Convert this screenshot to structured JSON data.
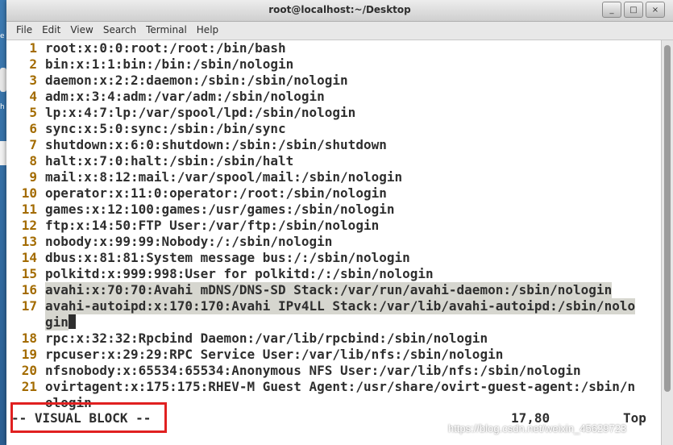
{
  "desktop": {
    "icon_labels": [
      "e",
      "h"
    ]
  },
  "window": {
    "title": "root@localhost:~/Desktop",
    "buttons": {
      "minimize": "_",
      "maximize": "□",
      "close": "×"
    }
  },
  "menu": [
    "File",
    "Edit",
    "View",
    "Search",
    "Terminal",
    "Help"
  ],
  "lines": [
    {
      "n": "1",
      "text": "root:x:0:0:root:/root:/bin/bash"
    },
    {
      "n": "2",
      "text": "bin:x:1:1:bin:/bin:/sbin/nologin"
    },
    {
      "n": "3",
      "text": "daemon:x:2:2:daemon:/sbin:/sbin/nologin"
    },
    {
      "n": "4",
      "text": "adm:x:3:4:adm:/var/adm:/sbin/nologin"
    },
    {
      "n": "5",
      "text": "lp:x:4:7:lp:/var/spool/lpd:/sbin/nologin"
    },
    {
      "n": "6",
      "text": "sync:x:5:0:sync:/sbin:/bin/sync"
    },
    {
      "n": "7",
      "text": "shutdown:x:6:0:shutdown:/sbin:/sbin/shutdown"
    },
    {
      "n": "8",
      "text": "halt:x:7:0:halt:/sbin:/sbin/halt"
    },
    {
      "n": "9",
      "text": "mail:x:8:12:mail:/var/spool/mail:/sbin/nologin"
    },
    {
      "n": "10",
      "text": "operator:x:11:0:operator:/root:/sbin/nologin"
    },
    {
      "n": "11",
      "text": "games:x:12:100:games:/usr/games:/sbin/nologin"
    },
    {
      "n": "12",
      "text": "ftp:x:14:50:FTP User:/var/ftp:/sbin/nologin"
    },
    {
      "n": "13",
      "text": "nobody:x:99:99:Nobody:/:/sbin/nologin"
    },
    {
      "n": "14",
      "text": "dbus:x:81:81:System message bus:/:/sbin/nologin"
    },
    {
      "n": "15",
      "text": "polkitd:x:999:998:User for polkitd:/:/sbin/nologin"
    },
    {
      "n": "16",
      "text": "avahi:x:70:70:Avahi mDNS/DNS-SD Stack:/var/run/avahi-daemon:/sbin/nologin",
      "selected": true
    },
    {
      "n": "17",
      "text": "avahi-autoipd:x:170:170:Avahi IPv4LL Stack:/var/lib/avahi-autoipd:/sbin/nolo",
      "selected": true
    },
    {
      "n": "",
      "text": "gin",
      "selected": true,
      "cursor": true
    },
    {
      "n": "18",
      "text": "rpc:x:32:32:Rpcbind Daemon:/var/lib/rpcbind:/sbin/nologin"
    },
    {
      "n": "19",
      "text": "rpcuser:x:29:29:RPC Service User:/var/lib/nfs:/sbin/nologin"
    },
    {
      "n": "20",
      "text": "nfsnobody:x:65534:65534:Anonymous NFS User:/var/lib/nfs:/sbin/nologin"
    },
    {
      "n": "21",
      "text": "ovirtagent:x:175:175:RHEV-M Guest Agent:/usr/share/ovirt-guest-agent:/sbin/n"
    },
    {
      "n": "",
      "text": "ologin"
    }
  ],
  "status": {
    "mode": "-- VISUAL BLOCK --",
    "position": "17,80",
    "scroll": "Top"
  },
  "annotation_color": "#e02020",
  "watermark": "https://blog.csdn.net/weixin_45629723"
}
